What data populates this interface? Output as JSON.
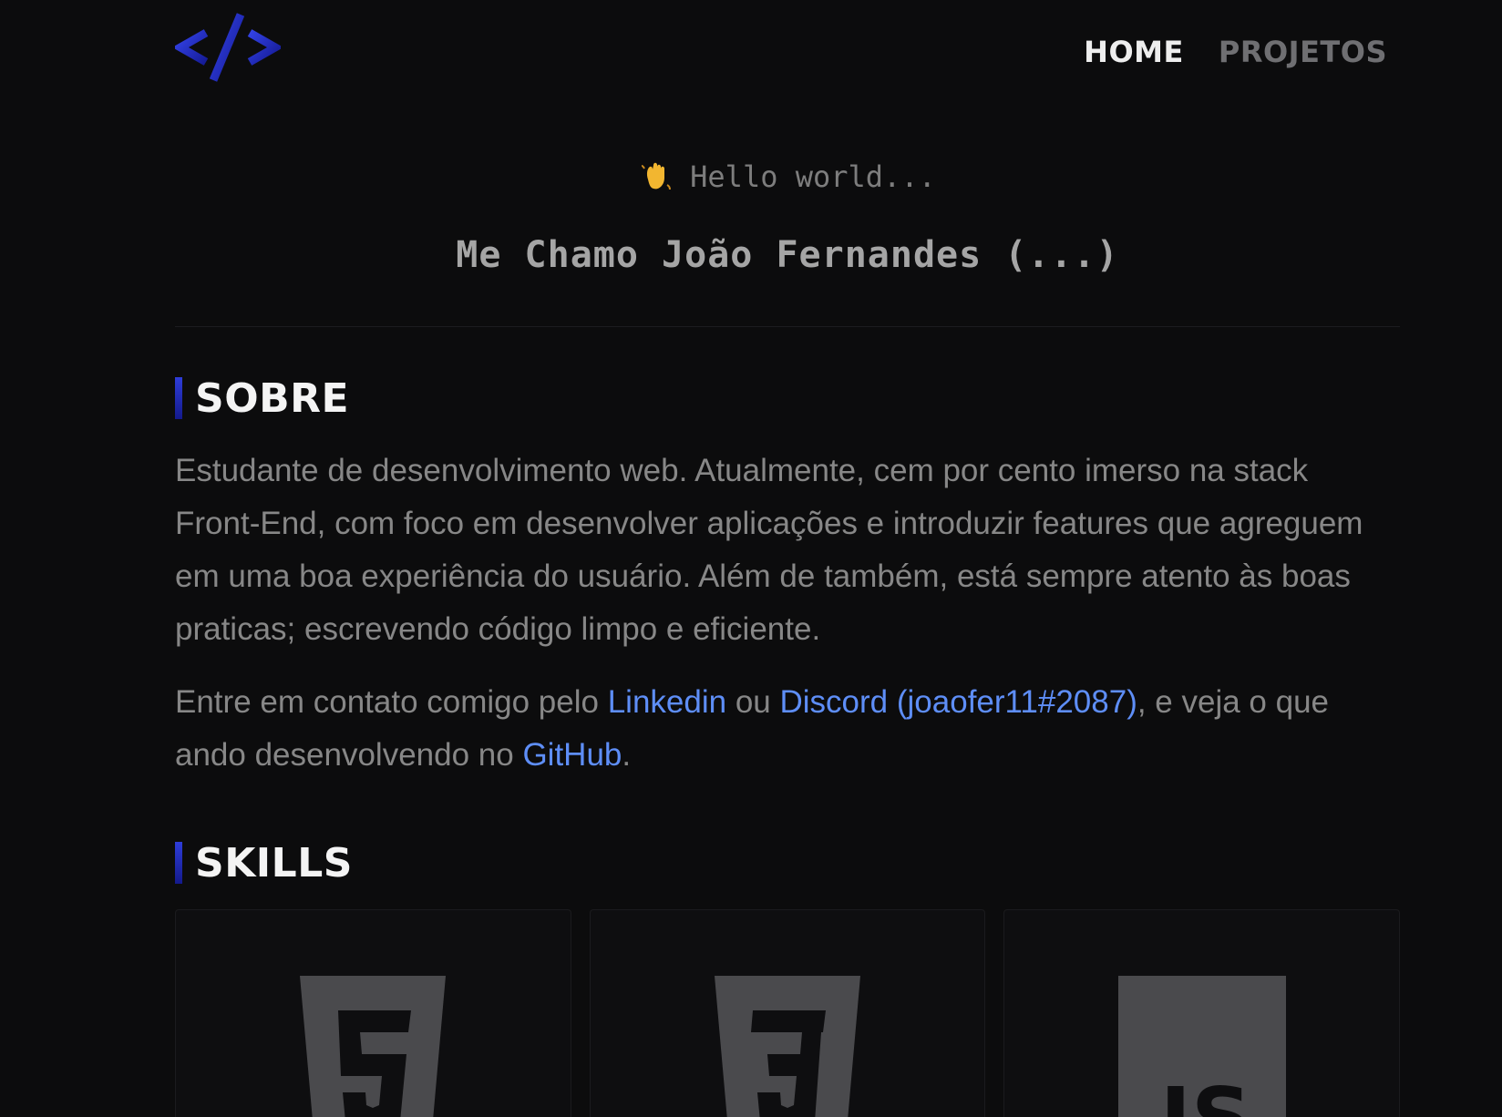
{
  "header": {
    "logo_icon": "code-brackets-icon",
    "nav": [
      {
        "label": "HOME",
        "active": true
      },
      {
        "label": "PROJETOS",
        "active": false
      }
    ]
  },
  "hero": {
    "greeting_icon": "waving-hand-icon",
    "greeting": "Hello world...",
    "name_line": "Me Chamo João Fernandes (...)"
  },
  "sobre": {
    "title": "SOBRE",
    "paragraph1": "Estudante de desenvolvimento web. Atualmente, cem por cento imerso na stack Front-End, com foco em desenvolver aplicações e introduzir features que agreguem em uma boa experiência do usuário. Além de também, está sempre atento às boas praticas; escrevendo código limpo e eficiente.",
    "contact_prefix": "Entre em contato comigo pelo ",
    "linkedin_label": "Linkedin",
    "contact_or": " ou ",
    "discord_label": "Discord (joaofer11#2087)",
    "contact_middle": ", e veja o que ando desenvolvendo no ",
    "github_label": "GitHub",
    "contact_suffix": "."
  },
  "skills": {
    "title": "SKILLS",
    "items": [
      {
        "icon": "html5-icon"
      },
      {
        "icon": "css3-icon"
      },
      {
        "icon": "javascript-icon"
      }
    ]
  },
  "colors": {
    "background": "#0c0c0d",
    "accent": "#2e3dd9",
    "link": "#5e8ef7",
    "text": "#878787",
    "heading": "#f4f4f4"
  }
}
